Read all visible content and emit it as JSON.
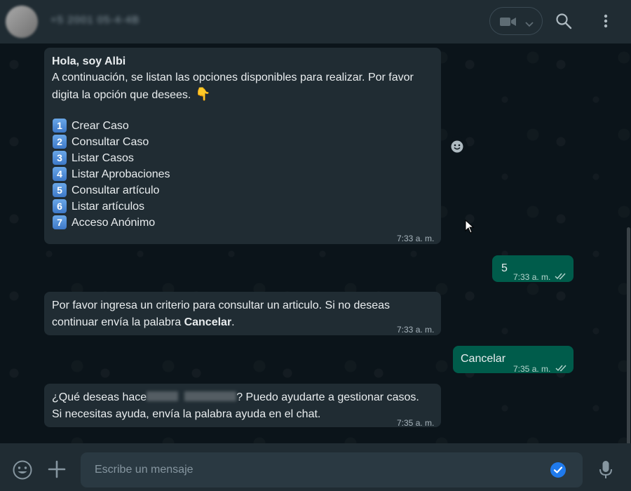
{
  "header": {
    "contact_name": "+5 2001 05-4-4B",
    "icons": [
      "avatar",
      "video-camera-icon",
      "chevron-down-icon",
      "search-icon",
      "more-vert-icon"
    ]
  },
  "messages": [
    {
      "direction": "in",
      "greeting": "Hola, soy Albi",
      "intro_line1": "A continuación, se listan las opciones disponibles para realizar. Por favor",
      "intro_line2": "digita la opción que desees.",
      "options": [
        {
          "num": "1",
          "label": "Crear Caso"
        },
        {
          "num": "2",
          "label": "Consultar Caso"
        },
        {
          "num": "3",
          "label": "Listar Casos"
        },
        {
          "num": "4",
          "label": "Listar Aprobaciones"
        },
        {
          "num": "5",
          "label": "Consultar artículo"
        },
        {
          "num": "6",
          "label": "Listar artículos"
        },
        {
          "num": "7",
          "label": "Acceso Anónimo"
        }
      ],
      "time": "7:33 a. m."
    },
    {
      "direction": "out",
      "text": "5",
      "time": "7:33 a. m."
    },
    {
      "direction": "in",
      "line1": "Por favor ingresa un criterio para consultar un articulo. Si no deseas",
      "line2_pre": "continuar envía la palabra ",
      "line2_bold": "Cancelar",
      "line2_post": ".",
      "time": "7:33 a. m."
    },
    {
      "direction": "out",
      "text": "Cancelar",
      "time": "7:35 a. m."
    },
    {
      "direction": "in",
      "line1_pre": "¿Qué deseas hace",
      "line1_post": "? Puedo ayudarte a gestionar casos.",
      "line2": "Si necesitas ayuda, envía la palabra ayuda en el chat.",
      "time": "7:35 a. m."
    }
  ],
  "composer": {
    "placeholder": "Escribe un mensaje"
  },
  "colors": {
    "background": "#0b141a",
    "header": "#202c33",
    "incoming_bubble": "#202c33",
    "outgoing_bubble": "#005c4b",
    "accent_blue": "#1f7aec"
  }
}
